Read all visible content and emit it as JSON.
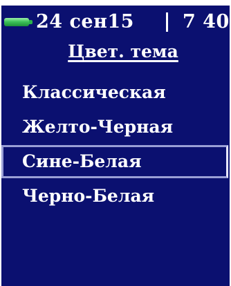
{
  "status": {
    "battery_icon": "battery-full-icon",
    "battery_color": "#3fc35a",
    "date": "24 сен15",
    "time": "7 40"
  },
  "page": {
    "title": "Цвет. тема"
  },
  "menu": {
    "items": [
      {
        "label": "Классическая",
        "selected": false
      },
      {
        "label": "Желто-Черная",
        "selected": false
      },
      {
        "label": "Сине-Белая",
        "selected": true
      },
      {
        "label": "Черно-Белая",
        "selected": false
      }
    ]
  },
  "colors": {
    "screen_background": "#0b1070",
    "text": "#ffffff",
    "selection_border": "#9a9fd6"
  }
}
